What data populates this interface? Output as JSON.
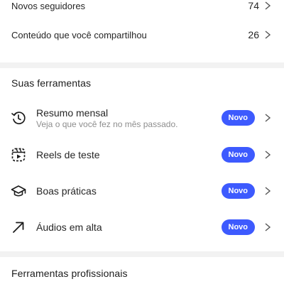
{
  "stats": [
    {
      "label": "Novos seguidores",
      "value": "74"
    },
    {
      "label": "Conteúdo que você compartilhou",
      "value": "26"
    }
  ],
  "tools": {
    "title": "Suas ferramentas",
    "items": [
      {
        "title": "Resumo mensal",
        "subtitle": "Veja o que você fez no mês passado.",
        "badge": "Novo",
        "icon": "history-icon"
      },
      {
        "title": "Reels de teste",
        "badge": "Novo",
        "icon": "reels-icon"
      },
      {
        "title": "Boas práticas",
        "badge": "Novo",
        "icon": "graduation-cap-icon"
      },
      {
        "title": "Áudios em alta",
        "badge": "Novo",
        "icon": "trending-arrow-icon"
      }
    ]
  },
  "pro_tools": {
    "title": "Ferramentas profissionais"
  },
  "colors": {
    "badge": "#3d5afe",
    "divider": "#f2f2f2"
  }
}
